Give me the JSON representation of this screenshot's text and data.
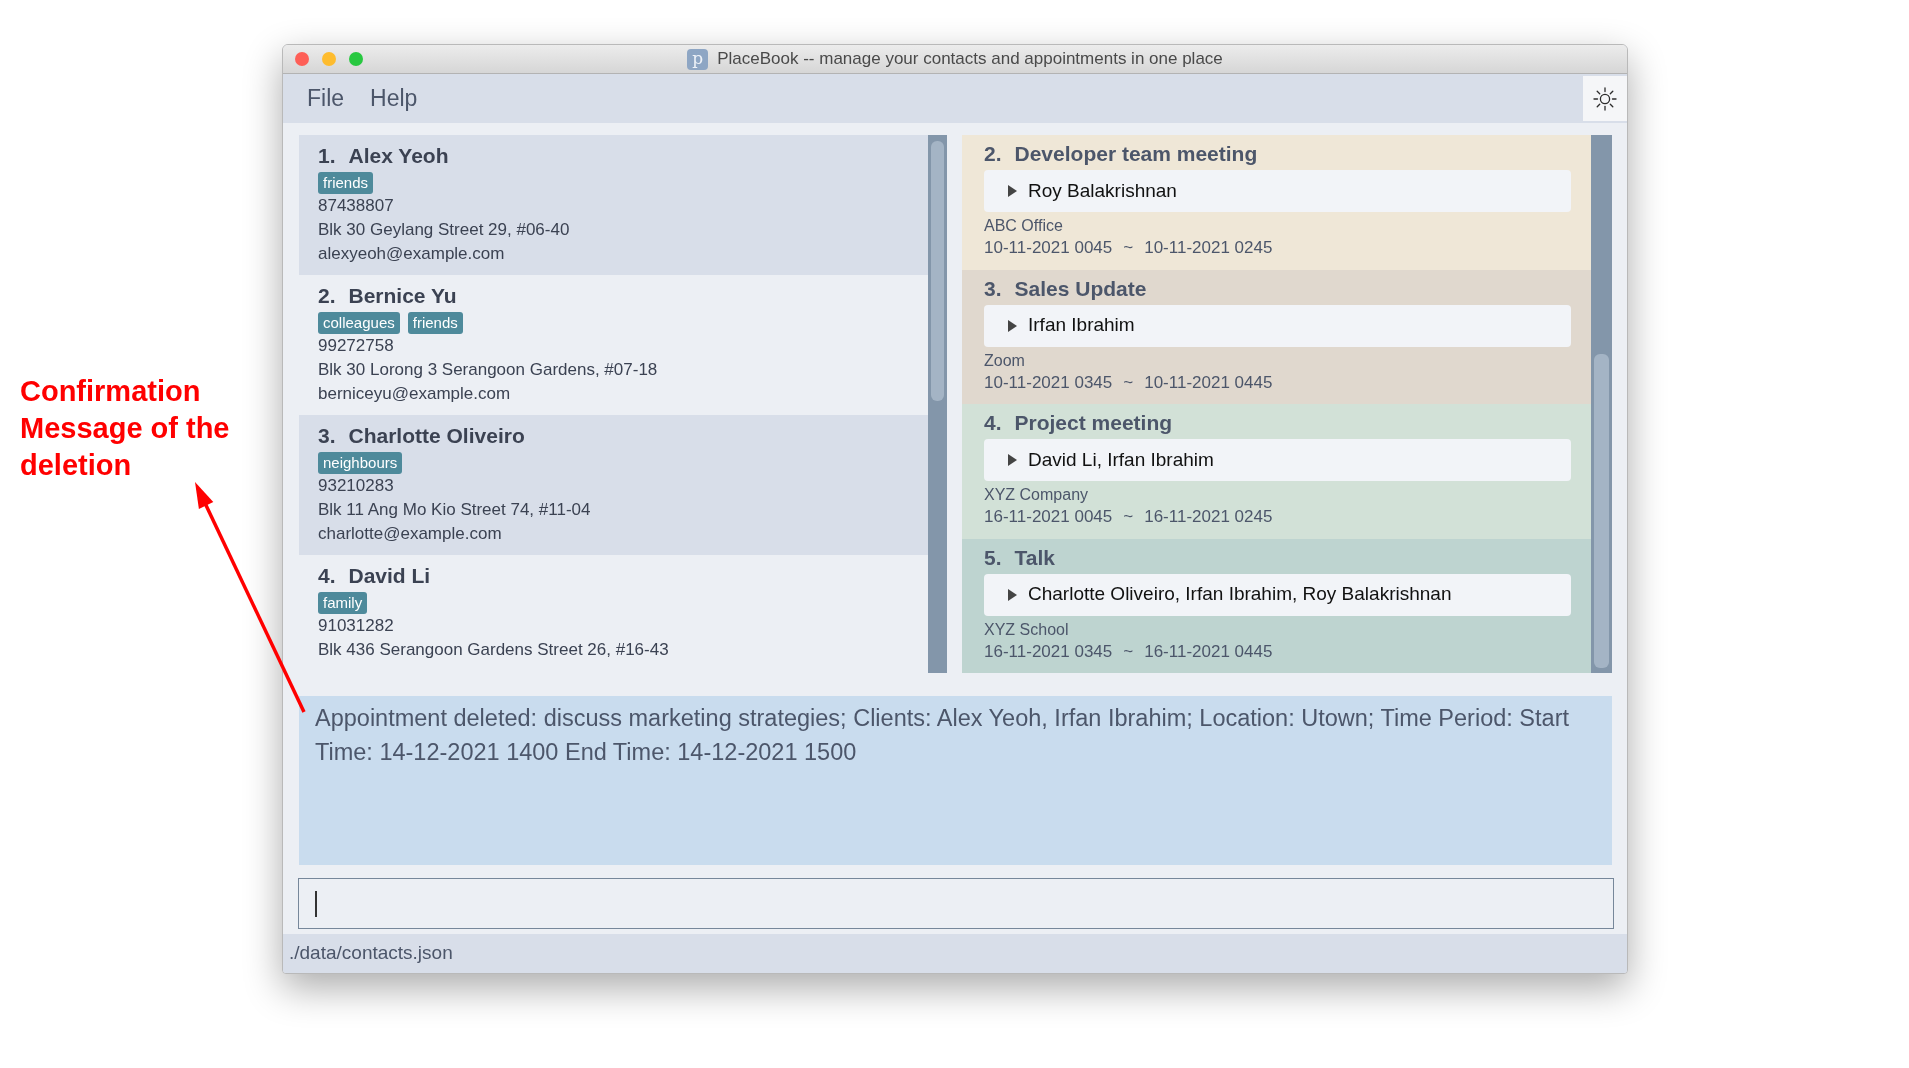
{
  "window": {
    "title": "PlaceBook -- manage your contacts and appointments in one place",
    "icon_letter": "p"
  },
  "menu": [
    {
      "label": "File"
    },
    {
      "label": "Help"
    }
  ],
  "contacts": [
    {
      "index": "1.",
      "name": "Alex Yeoh",
      "tags": [
        "friends"
      ],
      "phone": "87438807",
      "address": "Blk 30 Geylang Street 29, #06-40",
      "email": "alexyeoh@example.com"
    },
    {
      "index": "2.",
      "name": "Bernice Yu",
      "tags": [
        "colleagues",
        "friends"
      ],
      "phone": "99272758",
      "address": "Blk 30 Lorong 3 Serangoon Gardens, #07-18",
      "email": "berniceyu@example.com"
    },
    {
      "index": "3.",
      "name": "Charlotte Oliveiro",
      "tags": [
        "neighbours"
      ],
      "phone": "93210283",
      "address": "Blk 11 Ang Mo Kio Street 74, #11-04",
      "email": "charlotte@example.com"
    },
    {
      "index": "4.",
      "name": "David Li",
      "tags": [
        "family"
      ],
      "phone": "91031282",
      "address": "Blk 436 Serangoon Gardens Street 26, #16-43"
    }
  ],
  "appointments": [
    {
      "index": "2.",
      "title": "Developer team meeting",
      "color": "#efe7d7",
      "clients": "Roy Balakrishnan",
      "expanded": false,
      "location": "ABC Office",
      "start": "10-11-2021 0045",
      "separator": "~",
      "end": "10-11-2021 0245"
    },
    {
      "index": "3.",
      "title": "Sales Update",
      "color": "#e0d8ce",
      "clients": "Irfan Ibrahim",
      "expanded": false,
      "location": "Zoom",
      "start": "10-11-2021 0345",
      "separator": "~",
      "end": "10-11-2021 0445"
    },
    {
      "index": "4.",
      "title": "Project meeting",
      "color": "#d2e1d7",
      "clients": "David Li, Irfan Ibrahim",
      "expanded": false,
      "location": "XYZ Company",
      "start": "16-11-2021 0045",
      "separator": "~",
      "end": "16-11-2021 0245"
    },
    {
      "index": "5.",
      "title": "Talk",
      "color": "#bed4d0",
      "clients": "Charlotte Oliveiro, Irfan Ibrahim, Roy Balakrishnan",
      "expanded": false,
      "location": "XYZ School",
      "start": "16-11-2021 0345",
      "separator": "~",
      "end": "16-11-2021 0445"
    }
  ],
  "result_message": "Appointment deleted: discuss marketing strategies; Clients: Alex Yeoh, Irfan Ibrahim; Location: Utown; Time Period: Start Time: 14-12-2021 1400 End Time: 14-12-2021 1500",
  "status_bar": {
    "path": "./data/contacts.json"
  },
  "annotation": {
    "text": "Confirmation Message of the deletion"
  }
}
